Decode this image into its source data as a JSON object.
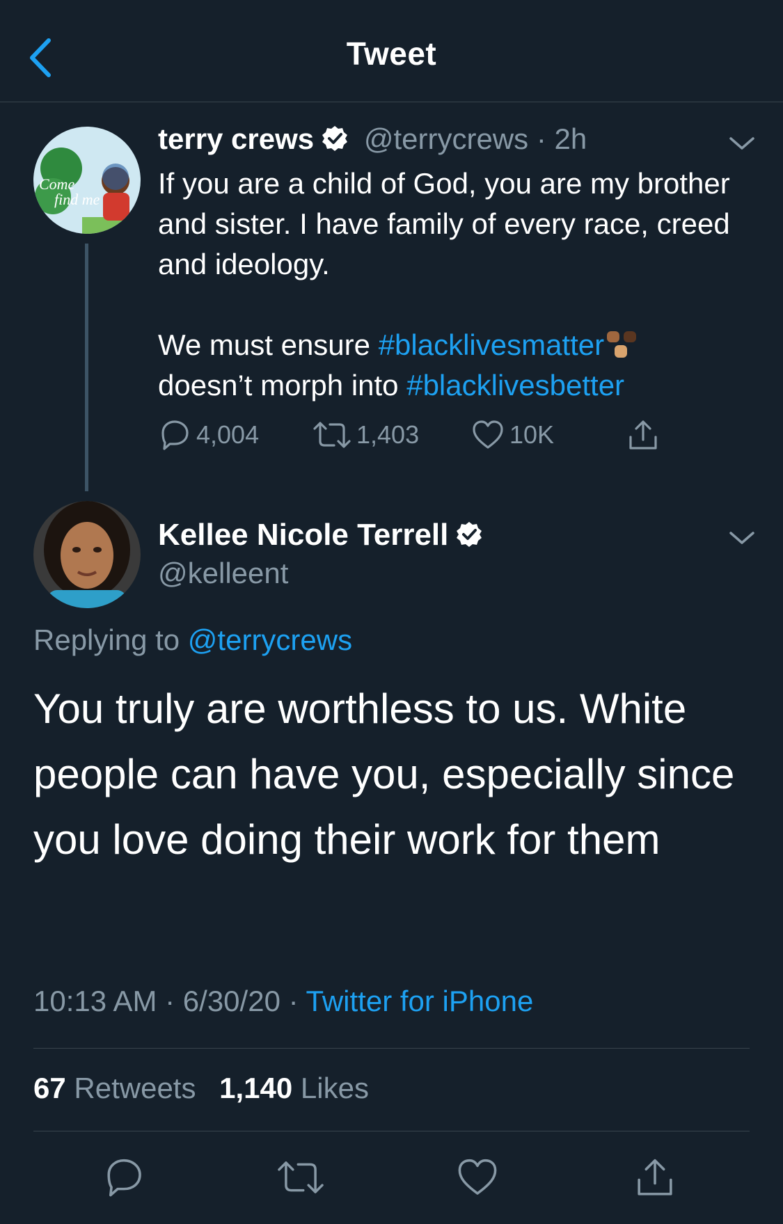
{
  "header": {
    "title": "Tweet"
  },
  "original_tweet": {
    "name": "terry crews",
    "handle": "@terrycrews",
    "separator": "·",
    "time": "2h",
    "line1": "If you are a child of God, you are my brother and sister. I have family of every race, creed and ideology.",
    "line2_prefix": "We must ensure ",
    "hashtag1": "#blacklivesmatter",
    "line2_mid": "doesn’t morph into ",
    "hashtag2": "#blacklivesbetter",
    "replies": "4,004",
    "retweets": "1,403",
    "likes": "10K"
  },
  "reply_tweet": {
    "name": "Kellee Nicole Terrell",
    "handle": "@kelleent",
    "replying_label": "Replying to ",
    "replying_to": "@terrycrews",
    "text": "You truly are worthless to us. White people can have you, especially since you love doing their work for them",
    "time": "10:13 AM",
    "sep1": " · ",
    "date": "6/30/20",
    "sep2": " · ",
    "source": "Twitter for iPhone",
    "retweet_count": "67",
    "retweet_label": "Retweets",
    "like_count": "1,140",
    "like_label": "Likes"
  },
  "colors": {
    "background": "#15202b",
    "accent": "#1da1f2",
    "muted": "#8899a6",
    "divider": "#38444d"
  }
}
